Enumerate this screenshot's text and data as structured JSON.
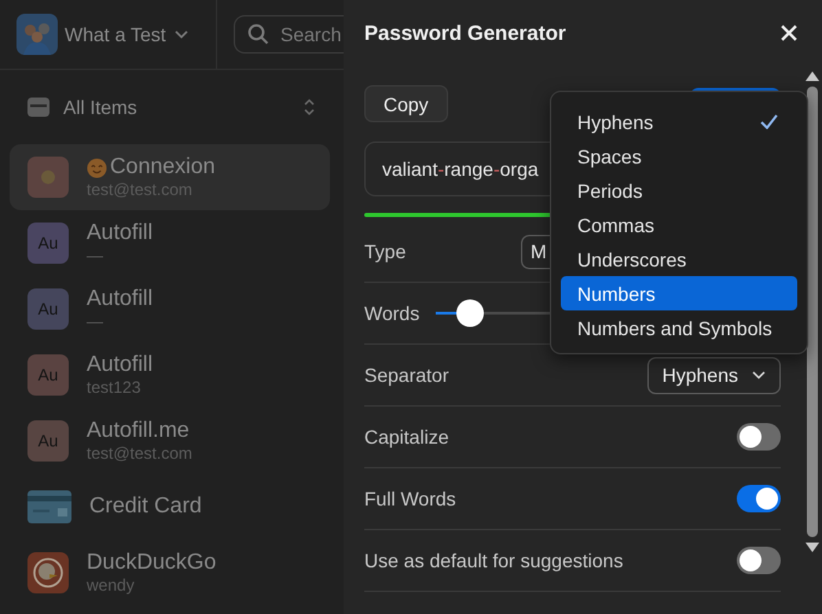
{
  "vault": {
    "name": "What a Test"
  },
  "search": {
    "placeholder": "Search"
  },
  "filter": {
    "label": "All Items"
  },
  "items": [
    {
      "kind": "login-emoji",
      "title": "Connexion",
      "subtitle": "test@test.com",
      "selected": true,
      "color": "#5c4340"
    },
    {
      "kind": "initials",
      "initials": "Au",
      "title": "Autofill",
      "subtitle": "—",
      "selected": false,
      "color": "#4a4561"
    },
    {
      "kind": "initials",
      "initials": "Au",
      "title": "Autofill",
      "subtitle": "—",
      "selected": false,
      "color": "#45465c"
    },
    {
      "kind": "initials",
      "initials": "Au",
      "title": "Autofill",
      "subtitle": "test123",
      "selected": false,
      "color": "#5a4341"
    },
    {
      "kind": "initials",
      "initials": "Au",
      "title": "Autofill.me",
      "subtitle": "test@test.com",
      "selected": false,
      "color": "#584542"
    },
    {
      "kind": "card",
      "title": "Credit Card",
      "selected": false,
      "color": "#3b5f72"
    },
    {
      "kind": "duck",
      "title": "DuckDuckGo",
      "subtitle": "wendy",
      "selected": false,
      "color": "#6a3424"
    }
  ],
  "panel": {
    "title": "Password Generator",
    "copy_button": "Copy",
    "password": [
      "valiant",
      "-",
      "range",
      "-",
      "orga"
    ],
    "rows": [
      {
        "kind": "select",
        "label": "Type",
        "value": "M"
      },
      {
        "kind": "slider",
        "label": "Words",
        "level": 0.1
      },
      {
        "kind": "select",
        "label": "Separator",
        "value": "Hyphens"
      },
      {
        "kind": "toggle",
        "label": "Capitalize",
        "on": false
      },
      {
        "kind": "toggle",
        "label": "Full Words",
        "on": true
      },
      {
        "kind": "toggle",
        "label": "Use as default for suggestions",
        "on": false
      }
    ]
  },
  "menu": [
    {
      "label": "Hyphens",
      "checked": true,
      "selected": false
    },
    {
      "label": "Spaces",
      "checked": false,
      "selected": false
    },
    {
      "label": "Periods",
      "checked": false,
      "selected": false
    },
    {
      "label": "Commas",
      "checked": false,
      "selected": false
    },
    {
      "label": "Underscores",
      "checked": false,
      "selected": false
    },
    {
      "label": "Numbers",
      "checked": false,
      "selected": true
    },
    {
      "label": "Numbers and Symbols",
      "checked": false,
      "selected": false
    }
  ]
}
